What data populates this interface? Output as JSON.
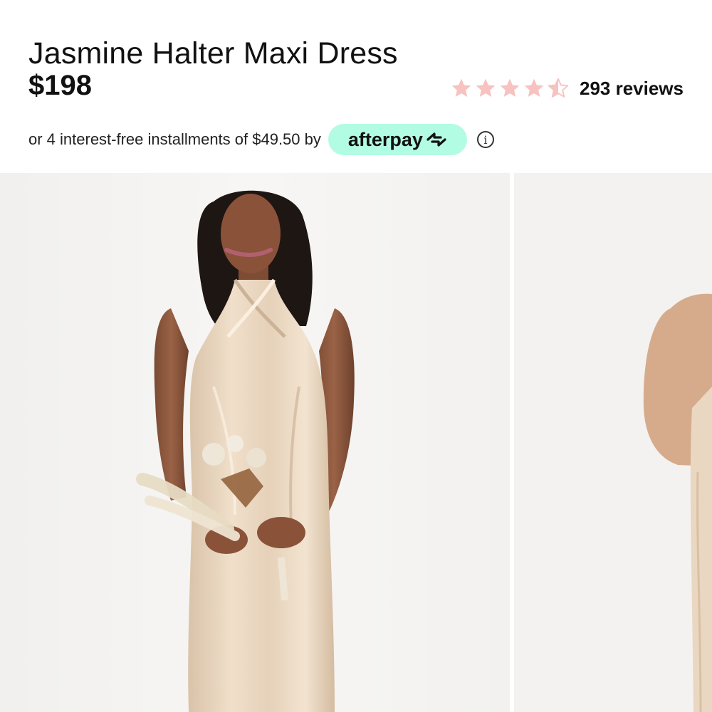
{
  "product": {
    "title": "Jasmine Halter Maxi Dress",
    "price": "$198",
    "rating": {
      "value": 4.5,
      "max": 5,
      "reviews_label": "293 reviews",
      "star_color": "#f7c2bf"
    }
  },
  "installments": {
    "text": "or 4 interest-free installments of $49.50 by",
    "provider": "afterpay",
    "pill_color": "#b2fce4",
    "info_icon": "info-circle-icon"
  },
  "gallery": {
    "images": [
      {
        "alt": "model-front-view"
      },
      {
        "alt": "model-side-view"
      }
    ]
  }
}
